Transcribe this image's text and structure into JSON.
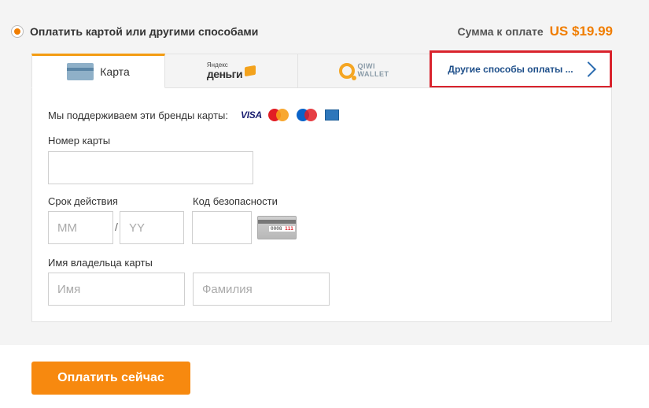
{
  "header": {
    "method_title": "Оплатить картой или другими способами",
    "sum_label": "Сумма к оплате",
    "sum_value": "US $19.99"
  },
  "tabs": [
    {
      "label": "Карта",
      "icon": "card-icon",
      "active": true
    },
    {
      "label": "ЯНДЕКС ДЕНЬГИ",
      "icon": "yandex-money-logo",
      "small": "Яндекс",
      "big": "деньги"
    },
    {
      "label": "QIWI WALLET",
      "icon": "qiwi-wallet-logo",
      "line1": "QIWI",
      "line2": "WALLET"
    },
    {
      "label": "Другие способы оплаты ...",
      "icon": "chevron-right-icon",
      "highlighted": true
    }
  ],
  "form": {
    "brands_label": "Мы поддерживаем эти бренды карты:",
    "brands": [
      "VISA",
      "MasterCard",
      "Maestro",
      "American Express"
    ],
    "card_number_label": "Номер карты",
    "card_number_value": "",
    "expiry_label": "Срок действия",
    "month_placeholder": "MM",
    "year_placeholder": "YY",
    "expiry_separator": "/",
    "security_label": "Код безопасности",
    "cvv_sample": "0008",
    "cvv_sample_code": "111",
    "holder_label": "Имя владельца карты",
    "first_name_placeholder": "Имя",
    "last_name_placeholder": "Фамилия"
  },
  "actions": {
    "pay_label": "Оплатить сейчас"
  },
  "colors": {
    "accent": "#f7890f",
    "price": "#f07d00",
    "highlight_border": "#d9232d",
    "link": "#1d4e89"
  }
}
